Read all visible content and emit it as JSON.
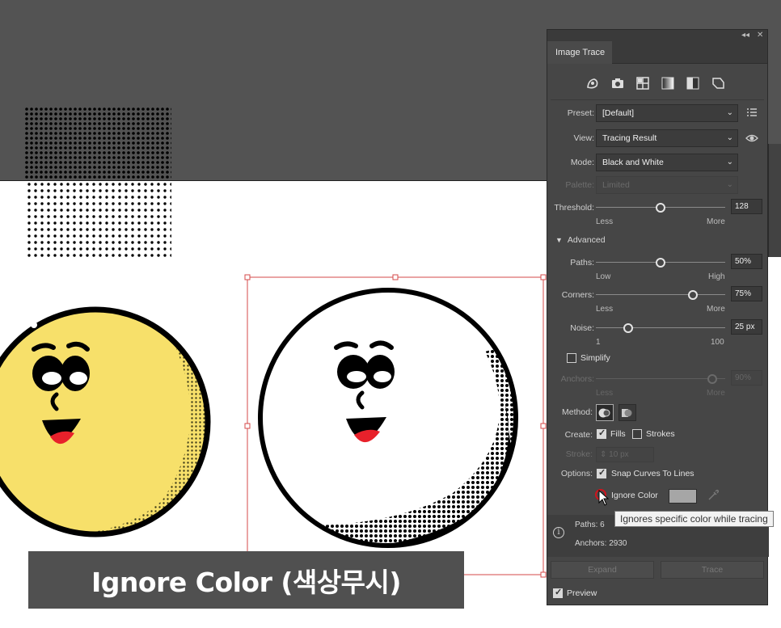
{
  "caption": "Ignore Color (색상무시)",
  "panel": {
    "title": "Image Trace",
    "collapse_glyph": "◂◂",
    "close_glyph": "✕",
    "preset_icons": [
      "auto-color-icon",
      "high-color-icon",
      "low-color-icon",
      "grayscale-icon",
      "black-and-white-icon",
      "outline-icon"
    ],
    "preset": {
      "label": "Preset:",
      "value": "[Default]"
    },
    "view": {
      "label": "View:",
      "value": "Tracing Result"
    },
    "mode": {
      "label": "Mode:",
      "value": "Black and White"
    },
    "palette": {
      "label": "Palette:",
      "value": "Limited"
    },
    "threshold": {
      "label": "Threshold:",
      "value": "128",
      "fraction": 0.5,
      "min_label": "Less",
      "max_label": "More"
    },
    "advanced_label": "Advanced",
    "paths": {
      "label": "Paths:",
      "value": "50%",
      "fraction": 0.5,
      "min_label": "Low",
      "max_label": "High"
    },
    "corners": {
      "label": "Corners:",
      "value": "75%",
      "fraction": 0.75,
      "min_label": "Less",
      "max_label": "More"
    },
    "noise": {
      "label": "Noise:",
      "value": "25 px",
      "fraction": 0.25,
      "min_label": "1",
      "max_label": "100"
    },
    "simplify": {
      "label": "Simplify",
      "checked": false
    },
    "anchors": {
      "label": "Anchors:",
      "value": "90%",
      "fraction": 0.9,
      "min_label": "Less",
      "max_label": "More"
    },
    "method_label": "Method:",
    "create": {
      "label": "Create:",
      "fills": "Fills",
      "fills_checked": true,
      "strokes": "Strokes",
      "strokes_checked": false
    },
    "stroke": {
      "label": "Stroke:",
      "value": "10 px"
    },
    "options": {
      "label": "Options:",
      "snap": "Snap Curves To Lines",
      "snap_checked": true
    },
    "ignore_color": {
      "label": "Ignore Color",
      "checked": false,
      "swatch": "#a6a6a6"
    },
    "stats": {
      "paths_label": "Paths:",
      "paths_value": "6",
      "anchors_label": "Anchors:",
      "anchors_value": "2930"
    },
    "expand_label": "Expand",
    "trace_label": "Trace",
    "preview": {
      "label": "Preview",
      "checked": true
    }
  },
  "tooltip": "Ignores specific color while tracing",
  "colors": {
    "yellow": "#f7e06a",
    "mouth": "#e8212b",
    "selection": "#d44a4a"
  }
}
